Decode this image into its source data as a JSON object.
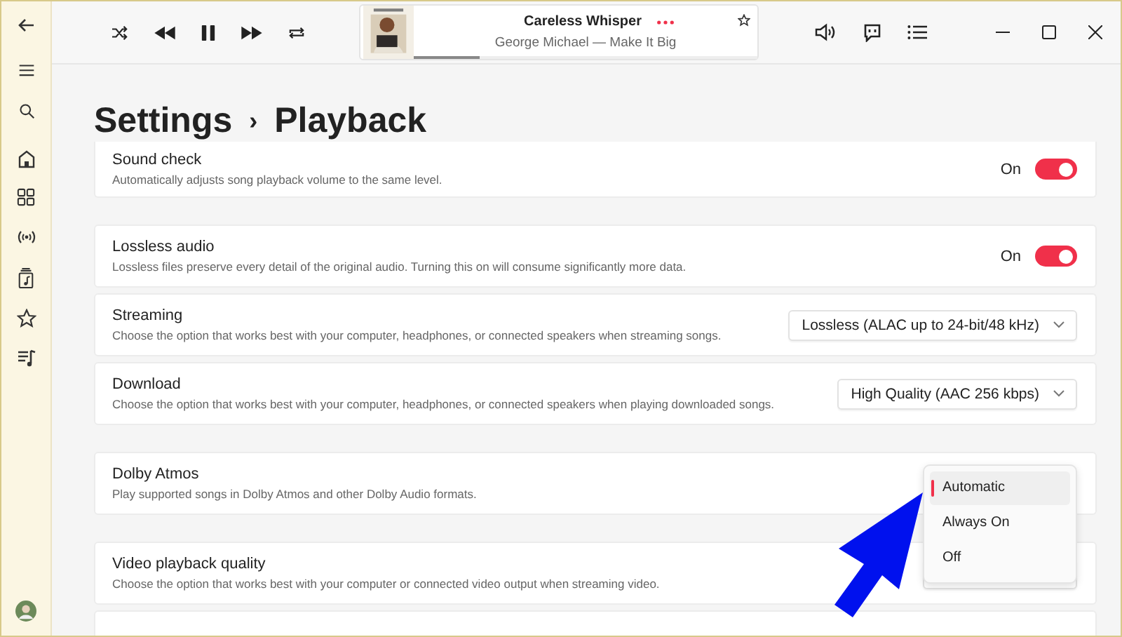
{
  "now_playing": {
    "title": "Careless Whisper",
    "subtitle": "George Michael — Make It Big",
    "level": 0.19
  },
  "breadcrumb": {
    "parent": "Settings",
    "separator": "›",
    "current": "Playback"
  },
  "groups": [
    {
      "cards": [
        {
          "kind": "toggle",
          "title": "Sound check",
          "description": "Automatically adjusts song playback volume to the same level.",
          "state_label": "On",
          "on": true
        }
      ]
    },
    {
      "cards": [
        {
          "kind": "toggle",
          "title": "Lossless audio",
          "description": "Lossless files preserve every detail of the original audio. Turning this on will consume significantly more data.",
          "state_label": "On",
          "on": true
        },
        {
          "kind": "dropdown",
          "title": "Streaming",
          "description": "Choose the option that works best with your computer, headphones, or connected speakers when streaming songs.",
          "value": "Lossless (ALAC up to 24-bit/48 kHz)"
        },
        {
          "kind": "dropdown",
          "title": "Download",
          "description": "Choose the option that works best with your computer, headphones, or connected speakers when playing downloaded songs.",
          "value": "High Quality (AAC 256 kbps)"
        }
      ]
    },
    {
      "cards": [
        {
          "kind": "menu",
          "title": "Dolby Atmos",
          "description": "Play supported songs in Dolby Atmos and other Dolby Audio formats.",
          "options": [
            {
              "label": "Automatic",
              "selected": true
            },
            {
              "label": "Always On",
              "selected": false
            },
            {
              "label": "Off",
              "selected": false
            }
          ]
        }
      ]
    },
    {
      "cards": [
        {
          "kind": "dropdown",
          "title": "Video playback quality",
          "description": "Choose the option that works best with your computer or connected video output when streaming video."
        }
      ]
    }
  ]
}
